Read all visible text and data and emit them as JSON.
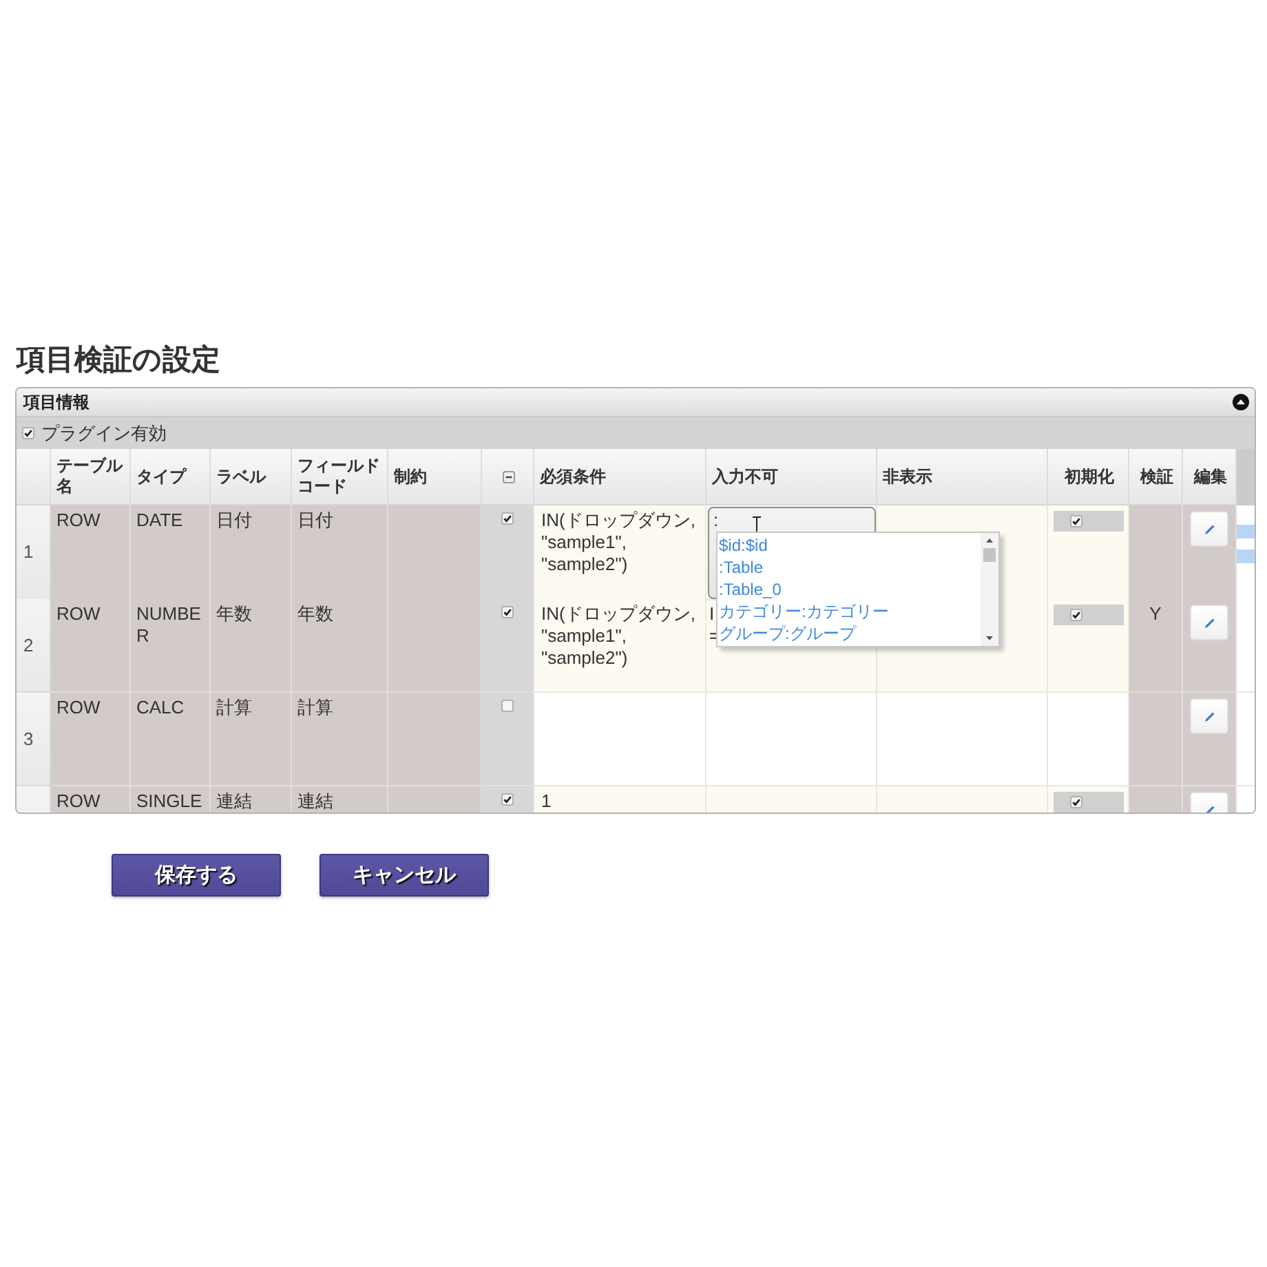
{
  "page": {
    "title": "項目検証の設定"
  },
  "panel": {
    "title": "項目情報",
    "expanded": true,
    "plugin": {
      "label": "プラグイン有効",
      "checked": true
    }
  },
  "table": {
    "columns": [
      {
        "kind": "text",
        "label": "テーブル名"
      },
      {
        "kind": "text",
        "label": "タイプ"
      },
      {
        "kind": "text",
        "label": "ラベル"
      },
      {
        "kind": "text",
        "label": "フィールドコード"
      },
      {
        "kind": "text",
        "label": "制約"
      },
      {
        "kind": "select_all"
      },
      {
        "kind": "text",
        "label": "必須条件"
      },
      {
        "kind": "text",
        "label": "入力不可"
      },
      {
        "kind": "text",
        "label": "非表示"
      },
      {
        "kind": "text",
        "label": "初期化"
      },
      {
        "kind": "text",
        "label": "検証"
      },
      {
        "kind": "text",
        "label": "編集"
      }
    ],
    "rows": [
      {
        "number": "1",
        "table_name": "ROW",
        "type": "DATE",
        "label": "日付",
        "field_code": "日付",
        "enabled": true,
        "required": "IN(ドロップダウン, \"sample1\", \"sample2\")",
        "input_disabled": {
          "kind": "editor",
          "value": ":",
          "suggestions": [
            {
              "label": "$id:$id",
              "selected": false
            },
            {
              "label": ":Table",
              "selected": false
            },
            {
              "label": ":Table_0",
              "selected": false
            },
            {
              "label": "カテゴリー:カテゴリー",
              "selected": false
            },
            {
              "label": "グループ:グループ",
              "selected": false
            }
          ]
        },
        "reset": {
          "checked": true
        }
      },
      {
        "number": "2",
        "table_name": "ROW",
        "type": "NUMBER",
        "label": "年数",
        "field_code": "年数",
        "enabled": true,
        "required": "IN(ドロップダウン, \"sample1\", \"sample2\")",
        "input_disabled": {
          "kind": "text",
          "value": "I\n="
        },
        "reset": {
          "checked": true
        },
        "validation": "Y"
      },
      {
        "number": "3",
        "table_name": "ROW",
        "type": "CALC",
        "label": "計算",
        "field_code": "計算",
        "enabled": false
      },
      {
        "table_name": "ROW",
        "type": "SINGLE",
        "label": "連結",
        "field_code": "連結",
        "enabled": true,
        "required": "1",
        "reset": {
          "checked": true
        }
      }
    ]
  },
  "buttons": [
    "保存する",
    "キャンセル"
  ]
}
